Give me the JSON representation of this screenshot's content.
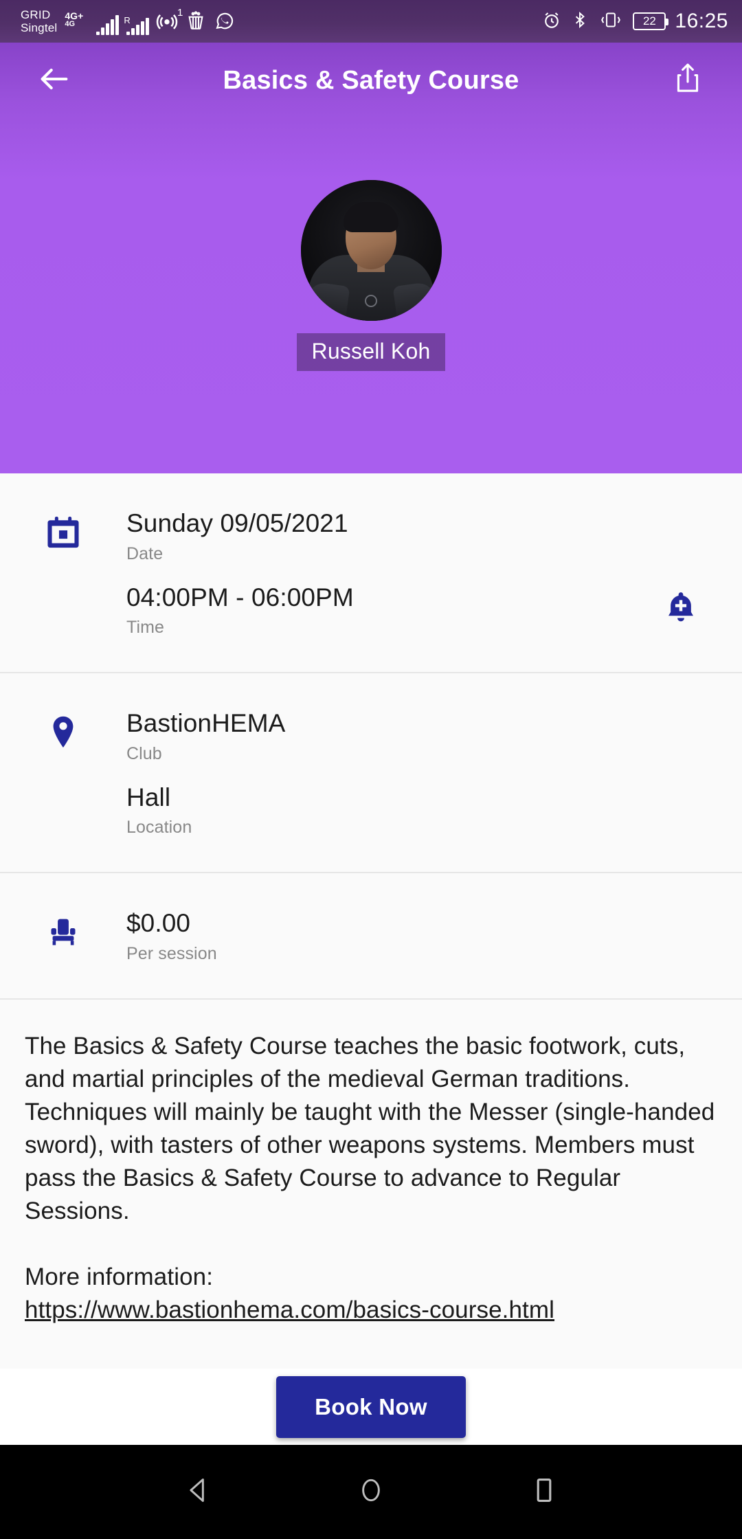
{
  "status_bar": {
    "carrier_line1": "GRID",
    "carrier_line2": "Singtel",
    "network_label": "4G",
    "network_plus": "+",
    "network_sublabel": "4G",
    "roaming_label": "R",
    "hotspot_badge": "1",
    "battery_percent": "22",
    "time": "16:25",
    "icons": [
      "alarm-icon",
      "bluetooth-icon",
      "vibrate-icon",
      "battery-icon"
    ]
  },
  "app_bar": {
    "title": "Basics & Safety Course",
    "back_icon": "arrow-left-icon",
    "share_icon": "share-icon"
  },
  "hero": {
    "instructor_name": "Russell Koh",
    "avatar_alt": "instructor-photo",
    "background_color": "#a85ced"
  },
  "details": {
    "sections": [
      {
        "icon": "calendar-icon",
        "rows": [
          {
            "value": "Sunday 09/05/2021",
            "label": "Date"
          },
          {
            "value": "04:00PM - 06:00PM",
            "label": "Time",
            "action_icon": "bell-plus-icon"
          }
        ]
      },
      {
        "icon": "location-pin-icon",
        "rows": [
          {
            "value": "BastionHEMA",
            "label": "Club"
          },
          {
            "value": "Hall",
            "label": "Location"
          }
        ]
      },
      {
        "icon": "seat-icon",
        "rows": [
          {
            "value": "$0.00",
            "label": "Per session"
          }
        ]
      }
    ]
  },
  "description": {
    "body": "The Basics & Safety Course teaches the basic footwork, cuts, and martial principles of the medieval German traditions. Techniques will mainly be taught with the Messer (single-handed sword), with tasters of other weapons systems. Members must pass the Basics & Safety Course to advance to Regular Sessions.",
    "more_info_label": "More information:",
    "more_info_url": "https://www.bastionhema.com/basics-course.html"
  },
  "cta": {
    "book_label": "Book Now",
    "color": "#24299b"
  },
  "nav_bar": {
    "back": "nav-back-icon",
    "home": "nav-home-icon",
    "recents": "nav-recents-icon"
  }
}
